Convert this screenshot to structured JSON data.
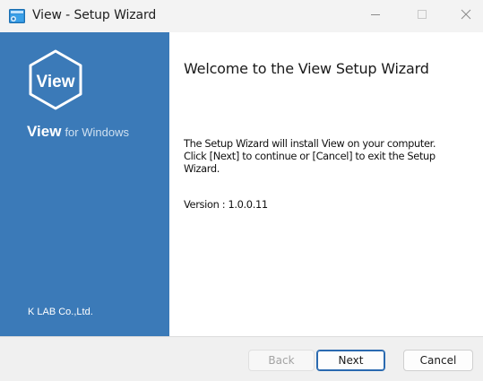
{
  "window": {
    "title": "View - Setup Wizard"
  },
  "banner": {
    "logo_text": "View",
    "brand_name": "View",
    "brand_suffix": "for Windows",
    "company": "K LAB Co.,Ltd."
  },
  "content": {
    "heading": "Welcome to the View Setup Wizard",
    "description_lines": [
      "The Setup Wizard will install View on your computer.",
      "Click [Next] to continue or [Cancel] to exit the Setup",
      "Wizard."
    ],
    "version": "Version : 1.0.0.11"
  },
  "buttons": {
    "back": "Back",
    "next": "Next",
    "cancel": "Cancel"
  },
  "colors": {
    "banner": "#3b7ab8",
    "titlebar": "#f3f3f3",
    "accent": "#2a6ab0"
  },
  "icons": {
    "app": "setup-app-icon",
    "minimize": "minimize-icon",
    "maximize": "maximize-icon",
    "close": "close-icon",
    "logo": "view-hexagon-logo"
  }
}
